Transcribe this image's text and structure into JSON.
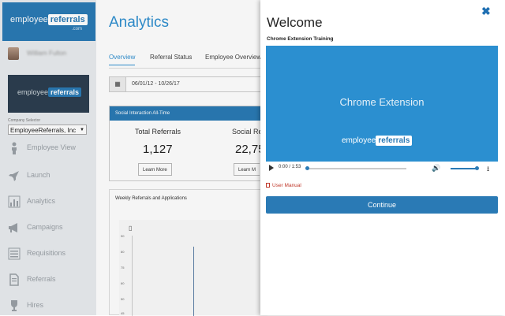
{
  "sidebar": {
    "logo": {
      "word1": "employee",
      "word2": "referrals",
      "suffix": ".com"
    },
    "user_name": "William Fulton",
    "banner": {
      "word1": "employee",
      "word2": "referrals"
    },
    "company_label": "Company Selector",
    "company_value": "EmployeeReferrals, Inc",
    "items": [
      {
        "label": "Employee View",
        "icon": "person-icon"
      },
      {
        "label": "Launch",
        "icon": "rocket-icon"
      },
      {
        "label": "Analytics",
        "icon": "bar-chart-icon"
      },
      {
        "label": "Campaigns",
        "icon": "megaphone-icon"
      },
      {
        "label": "Requisitions",
        "icon": "list-icon"
      },
      {
        "label": "Referrals",
        "icon": "document-icon"
      },
      {
        "label": "Hires",
        "icon": "trophy-icon"
      }
    ]
  },
  "main": {
    "title": "Analytics",
    "tabs": [
      "Overview",
      "Referral Status",
      "Employee Overview"
    ],
    "date_from": "06/01/12",
    "date_to": "10/26/17",
    "stats": {
      "header": "Social Interaction All-Time",
      "total_label": "Total Referrals",
      "total_value": "1,127",
      "social_label": "Social Re",
      "social_value": "22,75",
      "learn_more": "Learn More",
      "learn_more_partial": "Learn M"
    },
    "weekly": {
      "title": "Weekly Referrals and Applications",
      "y_ticks": [
        "90",
        "80",
        "75",
        "60",
        "50",
        "45"
      ]
    }
  },
  "modal": {
    "title": "Welcome",
    "close": "✖",
    "subtitle": "Chrome Extension Training",
    "video_title": "Chrome Extension",
    "video_logo": {
      "word1": "employee",
      "word2": "referrals"
    },
    "time": "0:00 / 1:53",
    "progress": 0.0,
    "volume": 1.0,
    "manual_label": "User Manual",
    "continue_label": "Continue"
  },
  "colors": {
    "accent": "#2a7ab5",
    "title_blue": "#2f8fd0",
    "video_bg": "#2b8fd0"
  }
}
